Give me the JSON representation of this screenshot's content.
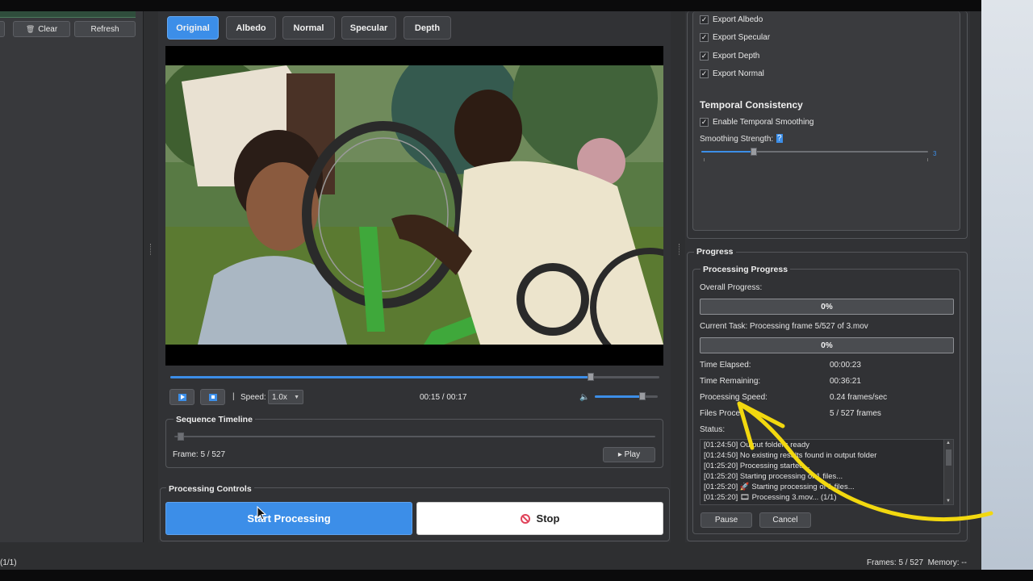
{
  "left_toolbar": {
    "clear_label": "Clear",
    "refresh_label": "Refresh"
  },
  "view_tabs": [
    {
      "label": "Original",
      "active": true
    },
    {
      "label": "Albedo",
      "active": false
    },
    {
      "label": "Normal",
      "active": false
    },
    {
      "label": "Specular",
      "active": false
    },
    {
      "label": "Depth",
      "active": false
    }
  ],
  "player": {
    "seek_position": 0.86,
    "speed_label": "Speed:",
    "speed_value": "1.0x",
    "time": "00:15 / 00:17",
    "volume": 0.75
  },
  "sequence_timeline": {
    "title": "Sequence Timeline",
    "position": 0.01,
    "frame_label": "Frame: 5 / 527",
    "play_label": "▸ Play"
  },
  "processing_controls": {
    "title": "Processing Controls",
    "start_label": "Start Processing",
    "stop_label": "Stop"
  },
  "export": [
    {
      "label": "Export Albedo",
      "checked": true
    },
    {
      "label": "Export Specular",
      "checked": true
    },
    {
      "label": "Export Depth",
      "checked": true
    },
    {
      "label": "Export Normal",
      "checked": true
    }
  ],
  "temporal": {
    "title": "Temporal Consistency",
    "enable_label": "Enable Temporal Smoothing",
    "enable_checked": true,
    "strength_label": "Smoothing Strength:",
    "strength_value": "?",
    "strength_max": "3",
    "strength_fraction": 0.23
  },
  "progress": {
    "group_title": "Progress",
    "inner_title": "Processing Progress",
    "overall_label": "Overall Progress:",
    "overall_value": "0%",
    "current_task": "Current Task: Processing frame 5/527 of 3.mov",
    "task_value": "0%",
    "stats": [
      {
        "key": "Time Elapsed:",
        "value": "00:00:23"
      },
      {
        "key": "Time Remaining:",
        "value": "00:36:21"
      },
      {
        "key": "Processing Speed:",
        "value": "0.24 frames/sec"
      },
      {
        "key": "Files Proces",
        "value": "5 / 527 frames"
      }
    ],
    "status_label": "Status:",
    "log": [
      "[01:24:50] Output folders ready",
      "[01:24:50] No existing results found in output folder",
      "[01:25:20] Processing started...",
      "[01:25:20] Starting processing of 1 files...",
      "[01:25:20] 🚀 Starting processing of 1 files...",
      "[01:25:20] 🎞 Processing 3.mov... (1/1)"
    ],
    "pause_label": "Pause",
    "cancel_label": "Cancel"
  },
  "status_bar": {
    "left": "(1/1)",
    "right": "Frames: 5 / 527  Memory: --"
  },
  "colors": {
    "accent": "#3c8ee8",
    "annotation": "#f2d80f",
    "panel": "#313235"
  }
}
